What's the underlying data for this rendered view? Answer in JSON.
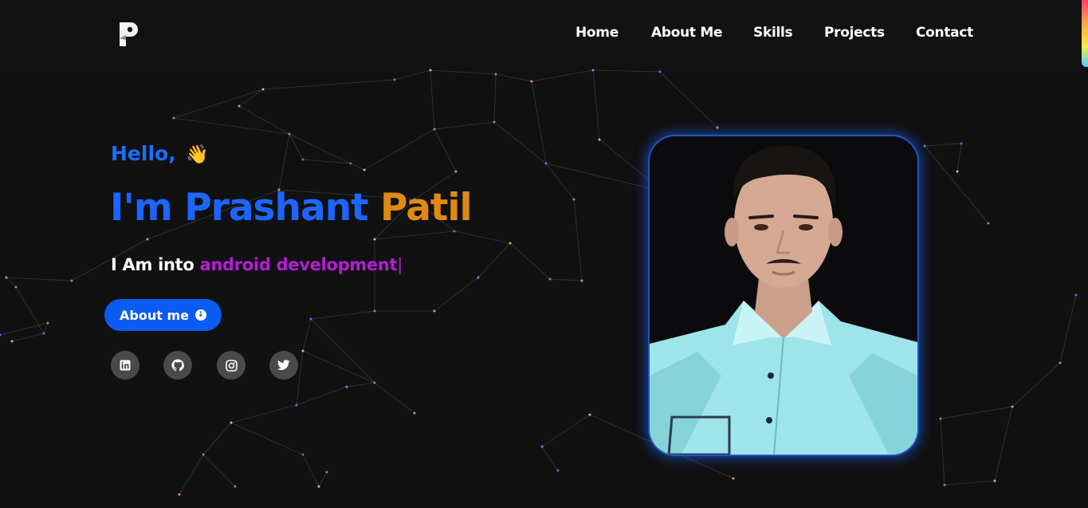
{
  "nav": {
    "logo_letter": "P",
    "links": [
      "Home",
      "About Me",
      "Skills",
      "Projects",
      "Contact"
    ]
  },
  "hero": {
    "greeting": "Hello,",
    "greeting_emoji": "👋",
    "name_first": "I'm Prashant",
    "name_last": "Patil",
    "tagline_static": "I Am into",
    "tagline_typed": "android development",
    "tagline_cursor": "|",
    "button_label": "About me",
    "button_icon": "arrow-down-circle-icon"
  },
  "socials": [
    "linkedin-icon",
    "github-icon",
    "instagram-icon",
    "twitter-icon"
  ],
  "colors": {
    "background": "#111112",
    "primary_blue": "#1c66ff",
    "accent_orange": "#e08a12",
    "accent_purple": "#b51dd6",
    "button_blue": "#0b5cf2",
    "social_bg": "#4a4a4c"
  }
}
